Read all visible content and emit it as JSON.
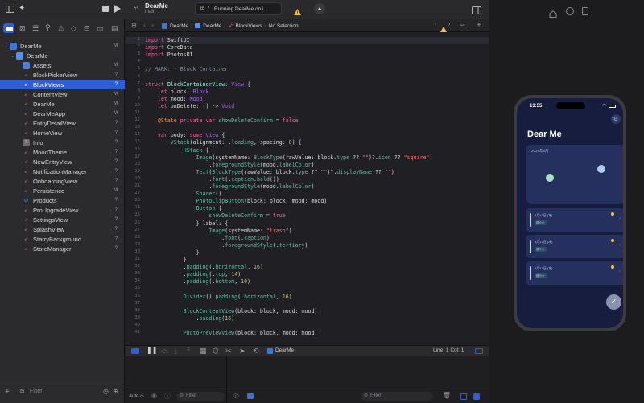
{
  "toolbar": {
    "project_name": "DearMe",
    "branch": "main",
    "run_status": "Running DearMe on i...",
    "scheme_glyph": "⌘"
  },
  "sidebar": {
    "items": [
      {
        "label": "DearMe",
        "badge": "M",
        "indent": 0,
        "kind": "project",
        "expanded": true
      },
      {
        "label": "DearMe",
        "badge": "",
        "indent": 1,
        "kind": "folder",
        "expanded": true
      },
      {
        "label": "Assets",
        "badge": "M",
        "indent": 2,
        "kind": "assets"
      },
      {
        "label": "BlockPickerView",
        "badge": "?",
        "indent": 2,
        "kind": "swift"
      },
      {
        "label": "BlockViews",
        "badge": "?",
        "indent": 2,
        "kind": "swift",
        "selected": true
      },
      {
        "label": "ContentView",
        "badge": "M",
        "indent": 2,
        "kind": "swift"
      },
      {
        "label": "DearMe",
        "badge": "M",
        "indent": 2,
        "kind": "swift"
      },
      {
        "label": "DearMeApp",
        "badge": "M",
        "indent": 2,
        "kind": "swift"
      },
      {
        "label": "EntryDetailView",
        "badge": "?",
        "indent": 2,
        "kind": "swift"
      },
      {
        "label": "HomeView",
        "badge": "?",
        "indent": 2,
        "kind": "swift"
      },
      {
        "label": "Info",
        "badge": "?",
        "indent": 2,
        "kind": "plist"
      },
      {
        "label": "MoodTheme",
        "badge": "?",
        "indent": 2,
        "kind": "swift"
      },
      {
        "label": "NewEntryView",
        "badge": "?",
        "indent": 2,
        "kind": "swift"
      },
      {
        "label": "NotificationManager",
        "badge": "?",
        "indent": 2,
        "kind": "swift"
      },
      {
        "label": "OnboardingView",
        "badge": "?",
        "indent": 2,
        "kind": "swift"
      },
      {
        "label": "Persistence",
        "badge": "M",
        "indent": 2,
        "kind": "swift"
      },
      {
        "label": "Products",
        "badge": "?",
        "indent": 2,
        "kind": "store"
      },
      {
        "label": "ProUpgradeView",
        "badge": "?",
        "indent": 2,
        "kind": "swift"
      },
      {
        "label": "SettingsView",
        "badge": "?",
        "indent": 2,
        "kind": "swift"
      },
      {
        "label": "SplashView",
        "badge": "?",
        "indent": 2,
        "kind": "swift"
      },
      {
        "label": "StarryBackground",
        "badge": "?",
        "indent": 2,
        "kind": "swift"
      },
      {
        "label": "StoreManager",
        "badge": "?",
        "indent": 2,
        "kind": "swift"
      }
    ],
    "filter_placeholder": "Filter"
  },
  "jumpbar": {
    "crumbs": [
      "DearMe",
      "DearMe",
      "BlockViews",
      "No Selection"
    ]
  },
  "code": {
    "lines": [
      [
        [
          "kw",
          "import"
        ],
        [
          "code",
          " SwiftUI"
        ]
      ],
      [
        [
          "kw",
          "import"
        ],
        [
          "code",
          " CoreData"
        ]
      ],
      [
        [
          "kw",
          "import"
        ],
        [
          "code",
          " PhotosUI"
        ]
      ],
      [],
      [
        [
          "cm",
          "// MARK: - Block Container"
        ]
      ],
      [],
      [
        [
          "kw",
          "struct"
        ],
        [
          "code",
          " "
        ],
        [
          "ty",
          "BlockContainerView"
        ],
        [
          "code",
          ": "
        ],
        [
          "tyf",
          "View"
        ],
        [
          "code",
          " {"
        ]
      ],
      [
        [
          "code",
          "    "
        ],
        [
          "kw",
          "let"
        ],
        [
          "code",
          " block: "
        ],
        [
          "tyf",
          "Block"
        ]
      ],
      [
        [
          "code",
          "    "
        ],
        [
          "kw",
          "let"
        ],
        [
          "code",
          " mood: "
        ],
        [
          "tyf",
          "Mood"
        ]
      ],
      [
        [
          "code",
          "    "
        ],
        [
          "kw",
          "let"
        ],
        [
          "code",
          " onDelete: () -> "
        ],
        [
          "tyf",
          "Void"
        ]
      ],
      [],
      [
        [
          "code",
          "    "
        ],
        [
          "at",
          "@State"
        ],
        [
          "code",
          " "
        ],
        [
          "kw",
          "private var"
        ],
        [
          "code",
          " "
        ],
        [
          "pr",
          "showDeleteConfirm"
        ],
        [
          "code",
          " = "
        ],
        [
          "kw",
          "false"
        ]
      ],
      [],
      [
        [
          "code",
          "    "
        ],
        [
          "kw",
          "var"
        ],
        [
          "code",
          " body: "
        ],
        [
          "kw",
          "some"
        ],
        [
          "code",
          " "
        ],
        [
          "tyf",
          "View"
        ],
        [
          "code",
          " {"
        ]
      ],
      [
        [
          "code",
          "        "
        ],
        [
          "fn",
          "VStack"
        ],
        [
          "code",
          "(alignment: ."
        ],
        [
          "fn",
          "leading"
        ],
        [
          "code",
          ", spacing: "
        ],
        [
          "nm",
          "0"
        ],
        [
          "code",
          ") {"
        ]
      ],
      [
        [
          "code",
          "            "
        ],
        [
          "fn",
          "HStack"
        ],
        [
          "code",
          " {"
        ]
      ],
      [
        [
          "code",
          "                "
        ],
        [
          "fn",
          "Image"
        ],
        [
          "code",
          "(systemName: "
        ],
        [
          "fn",
          "BlockType"
        ],
        [
          "code",
          "(rawValue: block."
        ],
        [
          "pr",
          "type"
        ],
        [
          "code",
          " ?? "
        ],
        [
          "st",
          "\"\""
        ],
        [
          "code",
          ")?."
        ],
        [
          "pr",
          "icon"
        ],
        [
          "code",
          " ?? "
        ],
        [
          "st",
          "\"square\""
        ],
        [
          "code",
          ")"
        ]
      ],
      [
        [
          "code",
          "                    ."
        ],
        [
          "fn",
          "foregroundStyle"
        ],
        [
          "code",
          "(mood."
        ],
        [
          "pr",
          "labelColor"
        ],
        [
          "code",
          ")"
        ]
      ],
      [
        [
          "code",
          "                "
        ],
        [
          "fn",
          "Text"
        ],
        [
          "code",
          "("
        ],
        [
          "fn",
          "BlockType"
        ],
        [
          "code",
          "(rawValue: block."
        ],
        [
          "pr",
          "type"
        ],
        [
          "code",
          " ?? "
        ],
        [
          "st",
          "\"\""
        ],
        [
          "code",
          ")?."
        ],
        [
          "pr",
          "displayName"
        ],
        [
          "code",
          " ?? "
        ],
        [
          "st",
          "\"\""
        ],
        [
          "code",
          ")"
        ]
      ],
      [
        [
          "code",
          "                    ."
        ],
        [
          "fn",
          "font"
        ],
        [
          "code",
          "(."
        ],
        [
          "fn",
          "caption"
        ],
        [
          "code",
          "."
        ],
        [
          "fn",
          "bold"
        ],
        [
          "code",
          "())"
        ]
      ],
      [
        [
          "code",
          "                    ."
        ],
        [
          "fn",
          "foregroundStyle"
        ],
        [
          "code",
          "(mood."
        ],
        [
          "pr",
          "labelColor"
        ],
        [
          "code",
          ")"
        ]
      ],
      [
        [
          "code",
          "                "
        ],
        [
          "fn",
          "Spacer"
        ],
        [
          "code",
          "()"
        ]
      ],
      [
        [
          "code",
          "                "
        ],
        [
          "fn",
          "PhotoClipButton"
        ],
        [
          "code",
          "(block: block, mood: mood)"
        ]
      ],
      [
        [
          "code",
          "                "
        ],
        [
          "fn",
          "Button"
        ],
        [
          "code",
          " {"
        ]
      ],
      [
        [
          "code",
          "                    "
        ],
        [
          "pr",
          "showDeleteConfirm"
        ],
        [
          "code",
          " = "
        ],
        [
          "kw",
          "true"
        ]
      ],
      [
        [
          "code",
          "                } label: {"
        ]
      ],
      [
        [
          "code",
          "                    "
        ],
        [
          "fn",
          "Image"
        ],
        [
          "code",
          "(systemName: "
        ],
        [
          "st",
          "\"trash\""
        ],
        [
          "code",
          ")"
        ]
      ],
      [
        [
          "code",
          "                        ."
        ],
        [
          "fn",
          "font"
        ],
        [
          "code",
          "(."
        ],
        [
          "fn",
          "caption"
        ],
        [
          "code",
          ")"
        ]
      ],
      [
        [
          "code",
          "                        ."
        ],
        [
          "fn",
          "foregroundStyle"
        ],
        [
          "code",
          "(."
        ],
        [
          "fn",
          "tertiary"
        ],
        [
          "code",
          ")"
        ]
      ],
      [
        [
          "code",
          "                }"
        ]
      ],
      [
        [
          "code",
          "            }"
        ]
      ],
      [
        [
          "code",
          "            ."
        ],
        [
          "fn",
          "padding"
        ],
        [
          "code",
          "(."
        ],
        [
          "fn",
          "horizontal"
        ],
        [
          "code",
          ", "
        ],
        [
          "nm",
          "16"
        ],
        [
          "code",
          ")"
        ]
      ],
      [
        [
          "code",
          "            ."
        ],
        [
          "fn",
          "padding"
        ],
        [
          "code",
          "(."
        ],
        [
          "fn",
          "top"
        ],
        [
          "code",
          ", "
        ],
        [
          "nm",
          "14"
        ],
        [
          "code",
          ")"
        ]
      ],
      [
        [
          "code",
          "            ."
        ],
        [
          "fn",
          "padding"
        ],
        [
          "code",
          "(."
        ],
        [
          "fn",
          "bottom"
        ],
        [
          "code",
          ", "
        ],
        [
          "nm",
          "10"
        ],
        [
          "code",
          ")"
        ]
      ],
      [],
      [
        [
          "code",
          "            "
        ],
        [
          "fn",
          "Divider"
        ],
        [
          "code",
          "()."
        ],
        [
          "fn",
          "padding"
        ],
        [
          "code",
          "(."
        ],
        [
          "fn",
          "horizontal"
        ],
        [
          "code",
          ", "
        ],
        [
          "nm",
          "16"
        ],
        [
          "code",
          ")"
        ]
      ],
      [],
      [
        [
          "code",
          "            "
        ],
        [
          "fn",
          "BlockContentView"
        ],
        [
          "code",
          "(block: block, mood: mood)"
        ]
      ],
      [
        [
          "code",
          "                ."
        ],
        [
          "fn",
          "padding"
        ],
        [
          "code",
          "("
        ],
        [
          "nm",
          "16"
        ],
        [
          "code",
          ")"
        ]
      ],
      [],
      [
        [
          "code",
          "            "
        ],
        [
          "fn",
          "PhotoPreviewView"
        ],
        [
          "code",
          "(block: block, mood: mood)"
        ]
      ]
    ]
  },
  "debug": {
    "target": "DearMe",
    "position": "Line: 1  Col: 1"
  },
  "console": {
    "auto_label": "Auto ◇",
    "filter_left": "Filter",
    "filter_right": "Filter"
  },
  "phone": {
    "time": "13:55",
    "title": "Dear Me",
    "month": "2026年8月",
    "entries": [
      {
        "date": "8月13日 (木)",
        "tag": "穏やか"
      },
      {
        "date": "8月13日 (木)",
        "tag": "穏やか"
      },
      {
        "date": "8月13日 (木)",
        "tag": "穏やか"
      }
    ],
    "fab": "✓"
  },
  "colors": {
    "accent": "#2e5dd6",
    "phone_bg": "#161d3e",
    "card_bg": "#25305e",
    "dot_green": "#a6dfc4",
    "dot_blue": "#a8cdf6",
    "warning": "#f5c33b"
  }
}
